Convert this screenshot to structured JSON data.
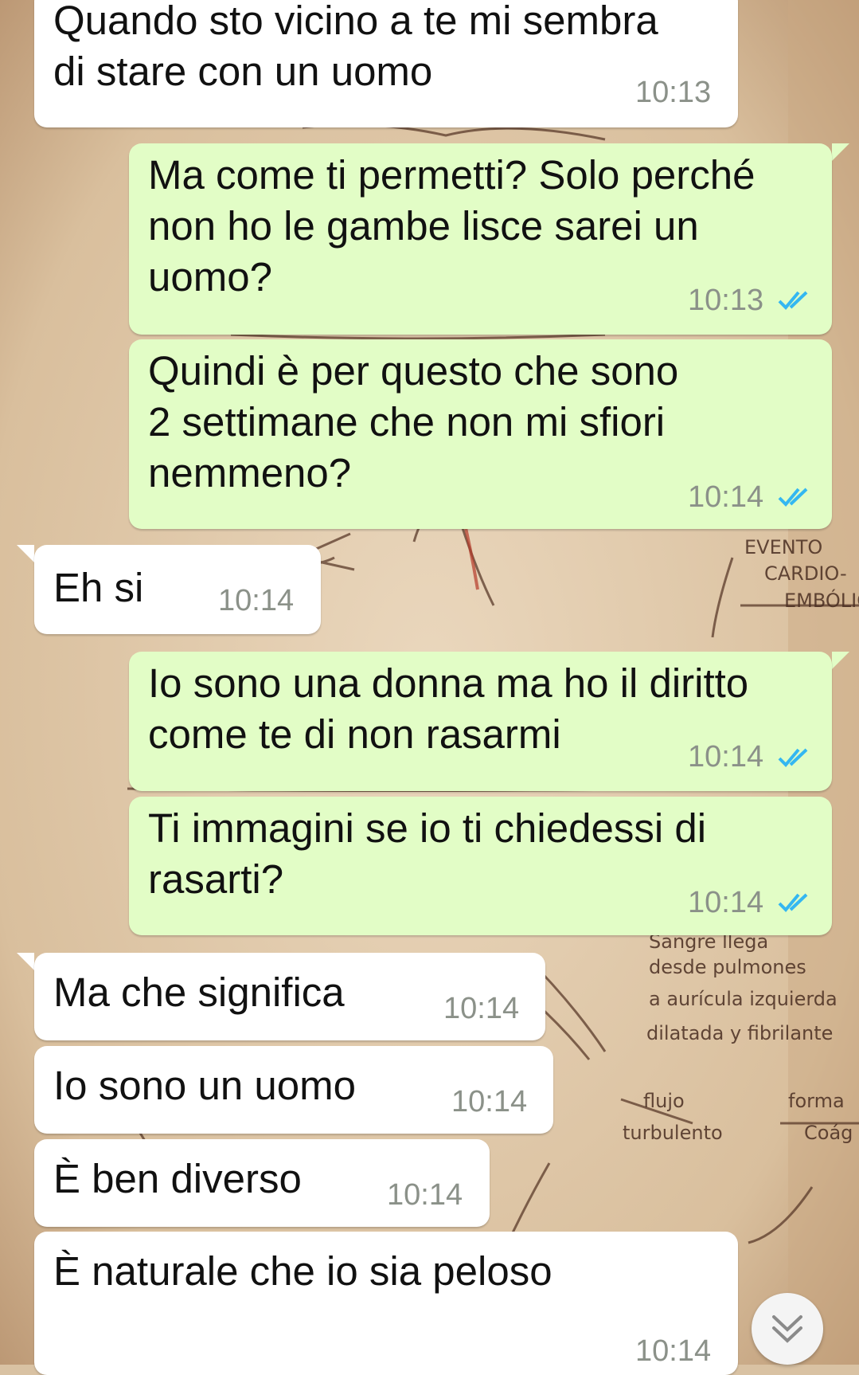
{
  "messages": [
    {
      "text": "Quando sto vicino a te mi sembra\ndi stare con un uomo",
      "time": "10:13"
    },
    {
      "text": "Ma come ti permetti? Solo perché\nnon ho le gambe lisce sarei un\nuomo?",
      "time": "10:13"
    },
    {
      "text": "Quindi è per questo che sono\n2 settimane che non mi sfiori\nnemmeno?",
      "time": "10:14"
    },
    {
      "text": "Eh si",
      "time": "10:14"
    },
    {
      "text": "Io sono una donna ma ho il diritto\ncome te di non rasarmi",
      "time": "10:14"
    },
    {
      "text": "Ti immagini se io ti chiedessi di\nrasarti?",
      "time": "10:14"
    },
    {
      "text": "Ma che significa",
      "time": "10:14"
    },
    {
      "text": "Io sono un uomo",
      "time": "10:14"
    },
    {
      "text": "È ben diverso",
      "time": "10:14"
    },
    {
      "text": "È naturale che io sia peloso",
      "time": "10:14"
    }
  ],
  "wallpaper_notes": {
    "evento": "EVENTO",
    "cardio": "CARDIO-",
    "embolic": "EMBÓLIC",
    "sangre": "Sangre llega",
    "desde": "desde pulmones",
    "auricula": "a aurícula izquierda",
    "dilatada": "dilatada y fibrilante",
    "flujo": "flujo",
    "turbulento": "turbulento",
    "forma": "forma",
    "coag": "Coág"
  },
  "colors": {
    "incoming_bubble": "#ffffff",
    "outgoing_bubble": "#e2fdc6",
    "read_ticks": "#34b7f1",
    "timestamp": "#8b9189"
  },
  "icons": {
    "read_receipt": "double-check-icon",
    "scroll_down": "chevron-double-down-icon"
  }
}
